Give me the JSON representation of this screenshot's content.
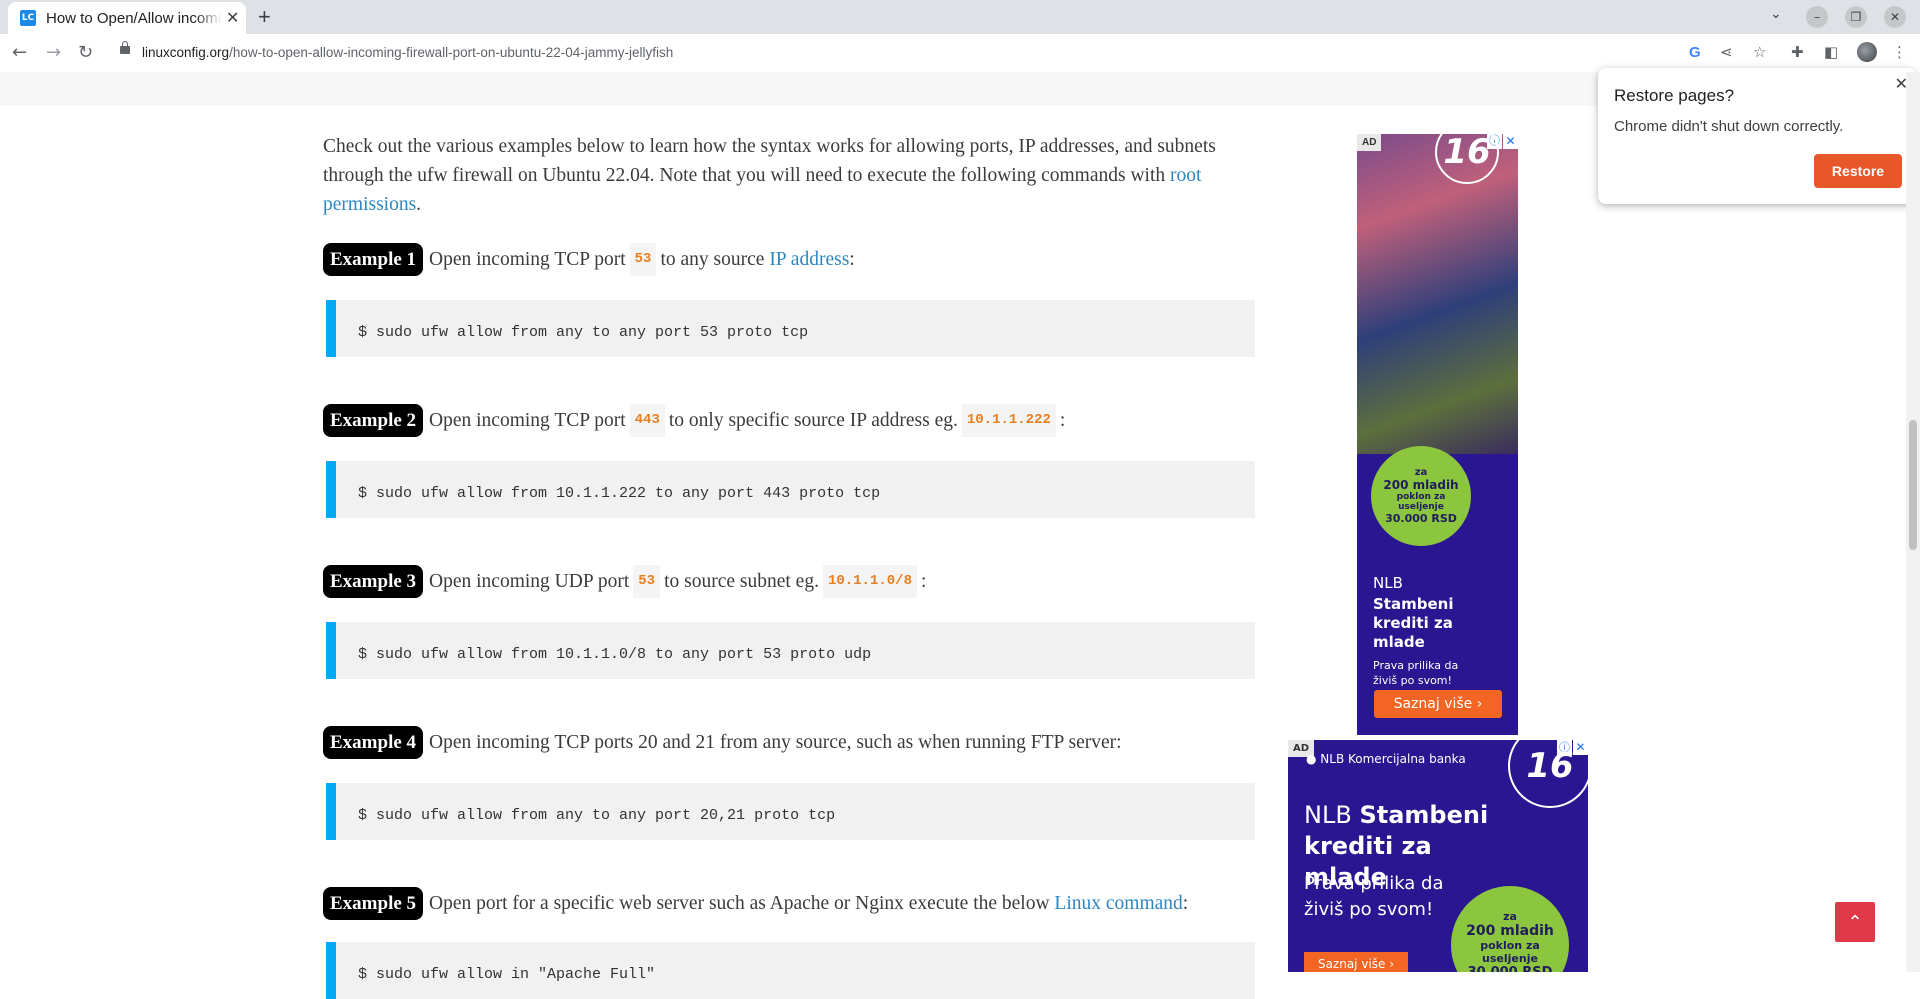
{
  "browser": {
    "tab_title": "How to Open/Allow incoming firewall port on Ubuntu",
    "tab_favicon": "LC",
    "new_tab": "+",
    "url_domain": "linuxconfig.org",
    "url_path": "/how-to-open-allow-incoming-firewall-port-on-ubuntu-22-04-jammy-jellyfish",
    "icons": [
      "back-icon",
      "forward-icon",
      "reload-icon",
      "lock-icon",
      "google-icon",
      "share-icon",
      "star-icon",
      "extensions-icon",
      "sidepanel-icon",
      "profile-icon",
      "menu-icon"
    ]
  },
  "article": {
    "intro_text": "Check out the various examples below to learn how the syntax works for allowing ports, IP addresses, and subnets through the ufw firewall on Ubuntu 22.04. Note that you will need to execute the following commands with ",
    "intro_link": "root permissions",
    "intro_end": ".",
    "examples": [
      {
        "badge": "Example 1",
        "pre": "Open incoming TCP port",
        "code": "53",
        "mid": "to any source",
        "link": "IP address",
        "post": ":",
        "cmd": "$ sudo ufw allow from any to any port 53 proto tcp"
      },
      {
        "badge": "Example 2",
        "pre": "Open incoming TCP port",
        "code": "443",
        "mid": "to only specific source IP address eg.",
        "code2": "10.1.1.222",
        "post": ":",
        "cmd": "$ sudo ufw allow from 10.1.1.222 to any port 443 proto tcp"
      },
      {
        "badge": "Example 3",
        "pre": "Open incoming UDP port",
        "code": "53",
        "mid": "to source subnet eg.",
        "code2": "10.1.1.0/8",
        "post": ":",
        "cmd": "$ sudo ufw allow from 10.1.1.0/8 to any port 53 proto udp"
      },
      {
        "badge": "Example 4",
        "pre": "Open incoming TCP ports 20 and 21 from any source, such as when running FTP server:",
        "cmd": "$ sudo ufw allow from any to any port 20,21 proto tcp"
      },
      {
        "badge": "Example 5",
        "pre": "Open port for a specific web server such as Apache or Nginx execute the below",
        "link": "Linux command",
        "post": ":",
        "cmd": "$ sudo ufw allow in \"Apache Full\""
      }
    ]
  },
  "ads": {
    "tag": "AD",
    "logo": "16",
    "circle_line1": "za",
    "circle_line2": "200 mladih",
    "circle_line3": "poklon za",
    "circle_line4": "useljenje",
    "circle_line5": "30.000 RSD",
    "brand": "NLB",
    "headline": "Stambeni krediti za mlade",
    "sub": "Prava prilika da živiš po svom!",
    "cta": "Saznaj više",
    "bank": "NLB Komercijalna banka",
    "headline_brand": "NLB"
  },
  "popup": {
    "title": "Restore pages?",
    "message": "Chrome didn't shut down correctly.",
    "button": "Restore"
  }
}
